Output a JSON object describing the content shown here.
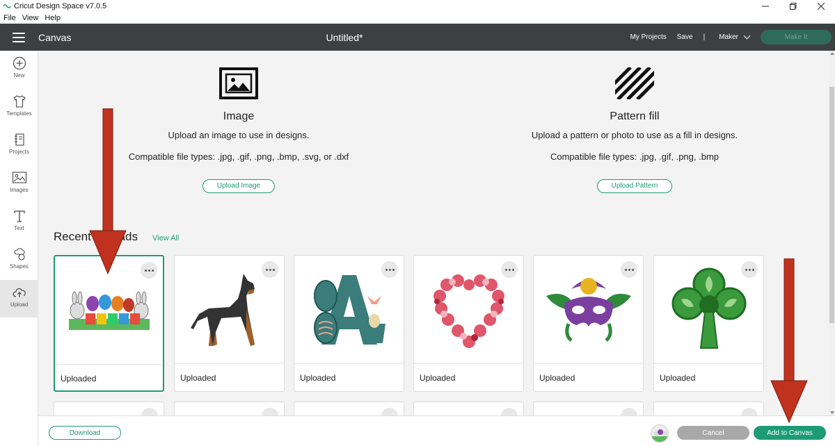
{
  "window": {
    "title": "Cricut Design Space  v7.0.5",
    "menu": [
      "File",
      "View",
      "Help"
    ]
  },
  "header": {
    "section": "Canvas",
    "doc_title": "Untitled*",
    "my_projects": "My Projects",
    "save": "Save",
    "separator": "|",
    "machine": "Maker",
    "make_it": "Make It"
  },
  "sidebar": {
    "items": [
      {
        "label": "New",
        "icon": "plus-circle-icon"
      },
      {
        "label": "Templates",
        "icon": "shirt-icon"
      },
      {
        "label": "Projects",
        "icon": "notebook-icon"
      },
      {
        "label": "Images",
        "icon": "image-icon"
      },
      {
        "label": "Text",
        "icon": "text-t-icon"
      },
      {
        "label": "Shapes",
        "icon": "shapes-icon"
      },
      {
        "label": "Upload",
        "icon": "cloud-upload-icon"
      }
    ],
    "active": "Upload"
  },
  "upload_image": {
    "heading": "Image",
    "description": "Upload an image to use in designs.",
    "file_types": "Compatible file types: .jpg, .gif, .png, .bmp, .svg, or .dxf",
    "button": "Upload Image"
  },
  "upload_pattern": {
    "heading": "Pattern fill",
    "description": "Upload a pattern or photo to use as a fill in designs.",
    "file_types": "Compatible file types: .jpg, .gif, .png, .bmp",
    "button": "Upload Pattern"
  },
  "recent": {
    "title": "Recent Uploads",
    "view_all": "View All",
    "cards": [
      {
        "label": "Uploaded",
        "subject": "Easter bunnies banner",
        "selected": true
      },
      {
        "label": "Uploaded",
        "subject": "Doberman dog",
        "selected": false
      },
      {
        "label": "Uploaded",
        "subject": "Easter letter A with eggs",
        "selected": false
      },
      {
        "label": "Uploaded",
        "subject": "Heart wreath",
        "selected": false
      },
      {
        "label": "Uploaded",
        "subject": "Mardi Gras mask",
        "selected": false
      },
      {
        "label": "Uploaded",
        "subject": "Celtic shamrock",
        "selected": false
      }
    ]
  },
  "footer": {
    "download": "Download",
    "cancel": "Cancel",
    "add_to_canvas": "Add to Canvas"
  },
  "colors": {
    "header_bg": "#3c4043",
    "accent": "#1c9c74",
    "annotation_arrow": "#c0321d"
  }
}
